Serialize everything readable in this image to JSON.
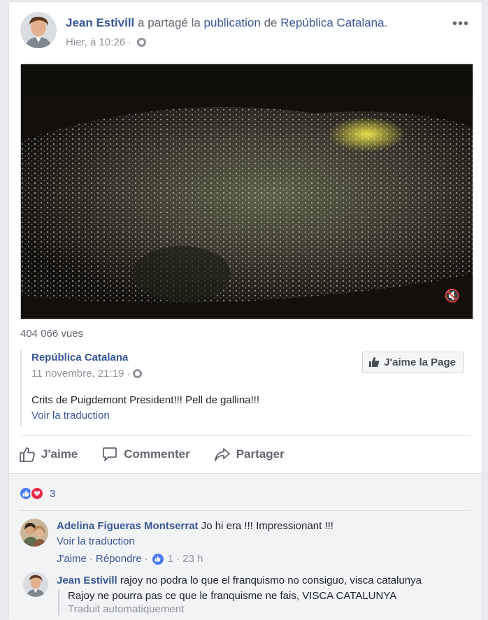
{
  "post": {
    "author": "Jean Estivill",
    "shared_text": "a partagé la",
    "publication_word": "publication",
    "of_word": "de",
    "source_page": "República Catalana",
    "period": ".",
    "timestamp": "Hier, à 10:26",
    "separator": "·",
    "more_icon": "•••"
  },
  "video": {
    "views": "404 066 vues",
    "mute_icon": "🔇"
  },
  "shared_post": {
    "page_name": "República Catalana",
    "date": "11 novembre, 21:19",
    "separator": "·",
    "like_page_label": "J'aime la Page",
    "text": "Crits de Puigdemont President!!! Pell de gallina!!!",
    "translate_label": "Voir la traduction"
  },
  "actions": {
    "like": "J'aime",
    "comment": "Commenter",
    "share": "Partager"
  },
  "reactions": {
    "count": "3"
  },
  "comments": [
    {
      "author": "Adelina Figueras Montserrat",
      "text": "Jo hi era !!! Impressionant !!!",
      "translate_label": "Voir la traduction",
      "like_label": "J'aime",
      "reply_label": "Répondre",
      "sep": "·",
      "like_count": "1",
      "time": "23 h"
    },
    {
      "author": "Jean Estivill",
      "text": "rajoy no podra lo que el franquismo no consiguo, visca catalunya",
      "translation": "Rajoy ne pourra pas ce que le franquisme ne fais, VISCA CATALUNYA",
      "auto_label": "Traduit automatiquement"
    }
  ],
  "colors": {
    "link": "#385898",
    "meta": "#90949c",
    "like_blue": "#4a7cf6",
    "love_red": "#f0284a"
  }
}
